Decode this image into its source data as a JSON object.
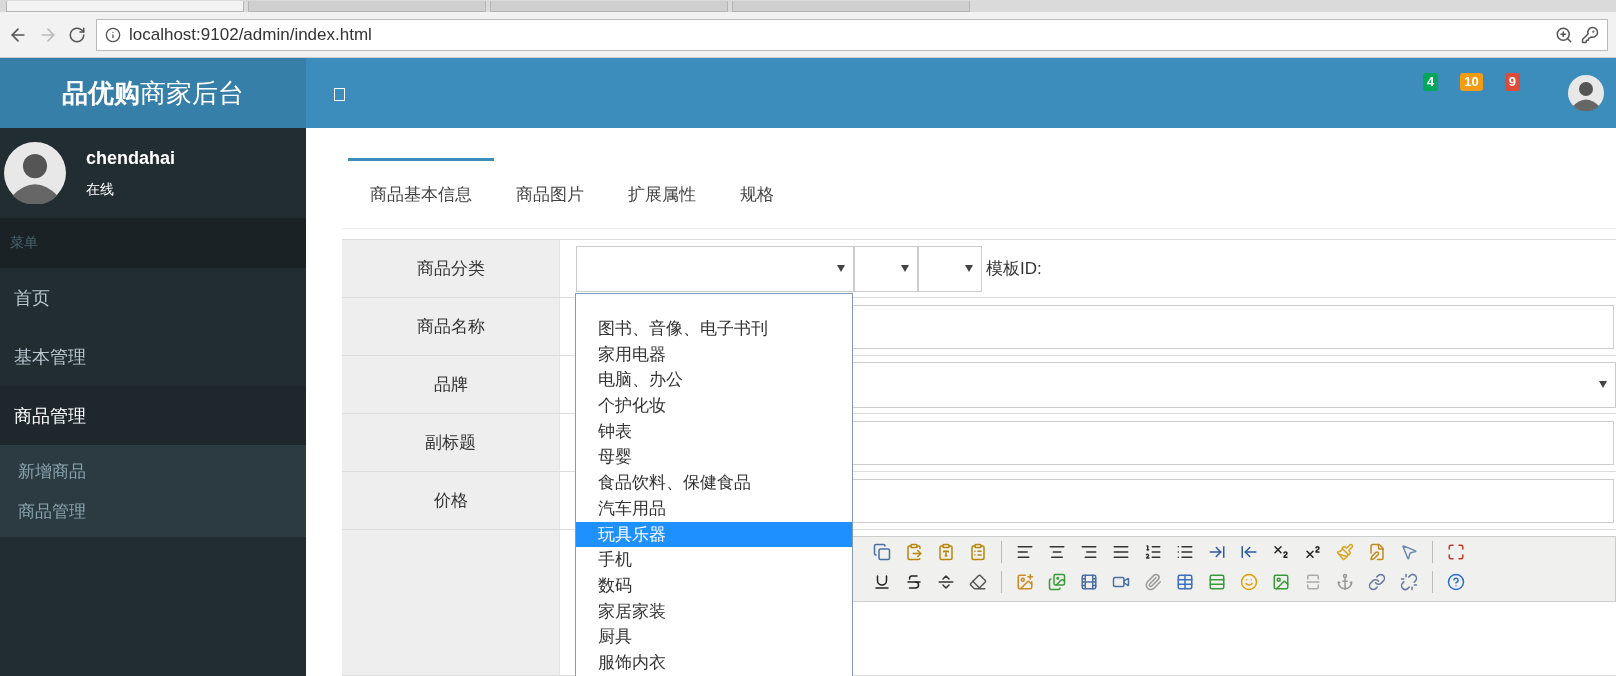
{
  "browser": {
    "tabs": [
      {
        "selected": true
      },
      {
        "selected": false
      },
      {
        "selected": false
      },
      {
        "selected": false
      }
    ],
    "address": "localhost:9102/admin/index.html"
  },
  "header": {
    "logo_bold": "品优购",
    "logo_rest": "商家后台",
    "badges": [
      {
        "count": "4",
        "color": "#00a65a"
      },
      {
        "count": "10",
        "color": "#f39c12"
      },
      {
        "count": "9",
        "color": "#dd4b39"
      }
    ]
  },
  "sidebar": {
    "user": {
      "name": "chendahai",
      "status": "在线"
    },
    "menu_header": "菜单",
    "items": [
      {
        "label": "首页",
        "expanded": false
      },
      {
        "label": "基本管理",
        "expanded": false
      },
      {
        "label": "商品管理",
        "expanded": true,
        "children": [
          {
            "label": "新增商品"
          },
          {
            "label": "商品管理"
          }
        ]
      }
    ]
  },
  "tabs": [
    {
      "label": "商品基本信息",
      "selected": true
    },
    {
      "label": "商品图片",
      "selected": false
    },
    {
      "label": "扩展属性",
      "selected": false
    },
    {
      "label": "规格",
      "selected": false
    }
  ],
  "form": {
    "rows": [
      {
        "label": "商品分类",
        "kind": "category"
      },
      {
        "label": "商品名称",
        "kind": "text"
      },
      {
        "label": "品牌",
        "kind": "select"
      },
      {
        "label": "副标题",
        "kind": "text"
      },
      {
        "label": "价格",
        "kind": "text"
      },
      {
        "kind": "editor"
      }
    ],
    "template_label": "模板ID:"
  },
  "category_dropdown": {
    "options": [
      {
        "label": "图书、音像、电子书刊",
        "selected": false
      },
      {
        "label": "家用电器",
        "selected": false
      },
      {
        "label": "电脑、办公",
        "selected": false
      },
      {
        "label": "个护化妆",
        "selected": false
      },
      {
        "label": "钟表",
        "selected": false
      },
      {
        "label": "母婴",
        "selected": false
      },
      {
        "label": "食品饮料、保健食品",
        "selected": false
      },
      {
        "label": "汽车用品",
        "selected": false
      },
      {
        "label": "玩具乐器",
        "selected": true
      },
      {
        "label": "手机",
        "selected": false
      },
      {
        "label": "数码",
        "selected": false
      },
      {
        "label": "家居家装",
        "selected": false
      },
      {
        "label": "厨具",
        "selected": false
      },
      {
        "label": "服饰内衣",
        "selected": false
      }
    ]
  }
}
